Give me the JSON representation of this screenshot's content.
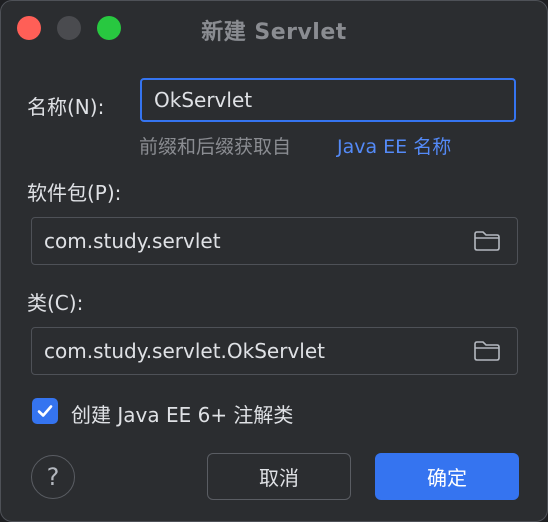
{
  "window": {
    "title": "新建 Servlet"
  },
  "form": {
    "name_label": "名称(N):",
    "name_value": "OkServlet",
    "hint_text": "前缀和后缀获取自",
    "hint_link": "Java EE 名称",
    "package_label": "软件包(P):",
    "package_value": "com.study.servlet",
    "class_label": "类(C):",
    "class_value": "com.study.servlet.OkServlet",
    "annotation_checkbox_label": "创建 Java EE 6+ 注解类",
    "annotation_checked": true
  },
  "footer": {
    "help_label": "?",
    "cancel_label": "取消",
    "ok_label": "确定"
  },
  "colors": {
    "accent": "#3574f0",
    "link": "#548af7",
    "close": "#ff5f57",
    "maximize": "#28c840"
  }
}
